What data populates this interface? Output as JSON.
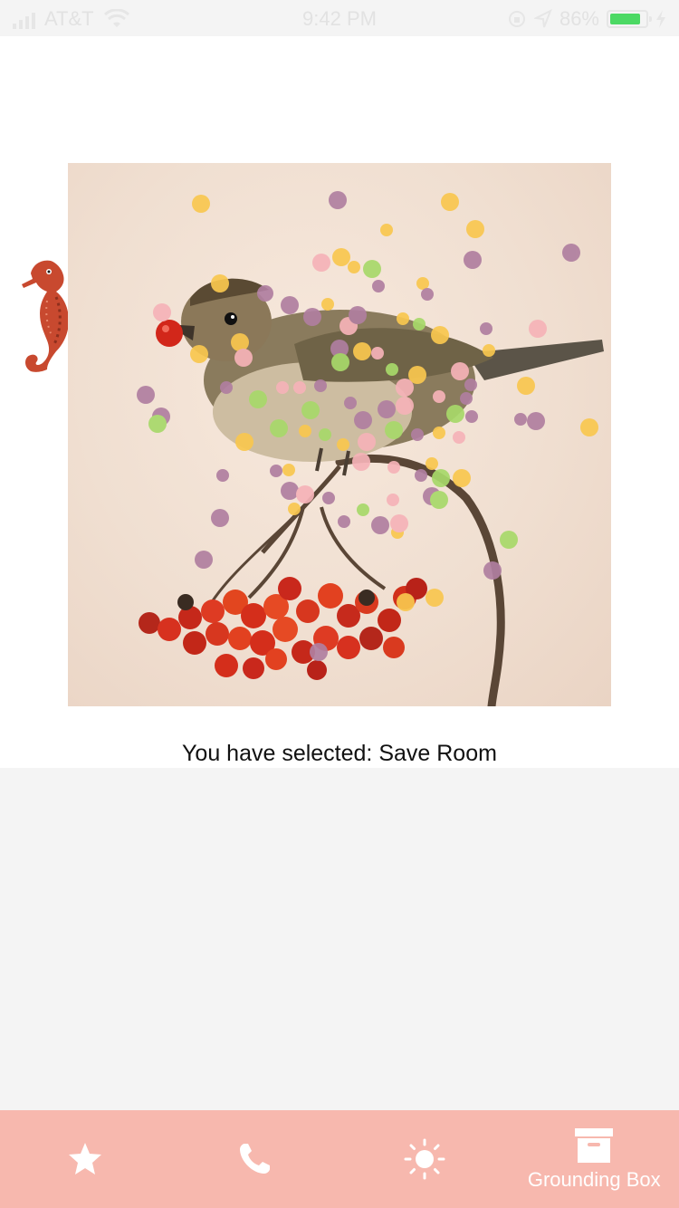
{
  "status_bar": {
    "carrier": "AT&T",
    "time": "9:42 PM",
    "battery_percent": "86%",
    "battery_level": 0.86,
    "icons": [
      "signal-icon",
      "wifi-icon",
      "orientation-lock-icon",
      "location-icon",
      "battery-icon",
      "charging-icon"
    ]
  },
  "main": {
    "mascot_icon": "seahorse-icon",
    "image_subject": "bird-with-berries",
    "selected_text": "You have selected: Save Room"
  },
  "tab_bar": {
    "background": "#f7b8ae",
    "tabs": [
      {
        "icon": "star-icon",
        "label": ""
      },
      {
        "icon": "phone-icon",
        "label": ""
      },
      {
        "icon": "sun-icon",
        "label": ""
      },
      {
        "icon": "archive-box-icon",
        "label": "Grounding Box"
      }
    ]
  },
  "colors": {
    "accent": "#f7b8ae",
    "confetti": [
      "#f9c74f",
      "#b07fa0",
      "#a8d96a",
      "#f6b3b8"
    ]
  }
}
